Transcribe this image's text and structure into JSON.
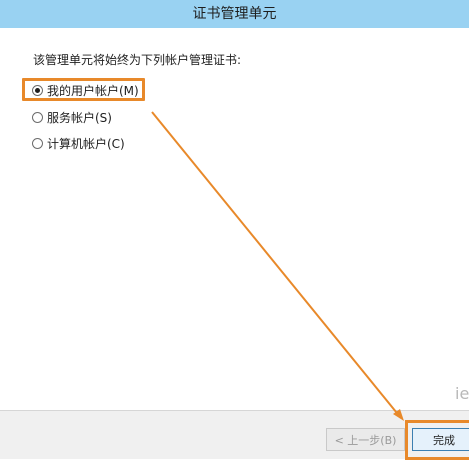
{
  "window": {
    "title": "证书管理单元"
  },
  "main": {
    "prompt": "该管理单元将始终为下列帐户管理证书:",
    "options": [
      {
        "label": "我的用户帐户(M)",
        "checked": true
      },
      {
        "label": "服务帐户(S)",
        "checked": false
      },
      {
        "label": "计算机帐户(C)",
        "checked": false
      }
    ]
  },
  "footer": {
    "back_label": "< 上一步(B)",
    "finish_label": "完成"
  },
  "watermark": {
    "text": "ie"
  },
  "annotation": {
    "color": "#e8892a"
  }
}
